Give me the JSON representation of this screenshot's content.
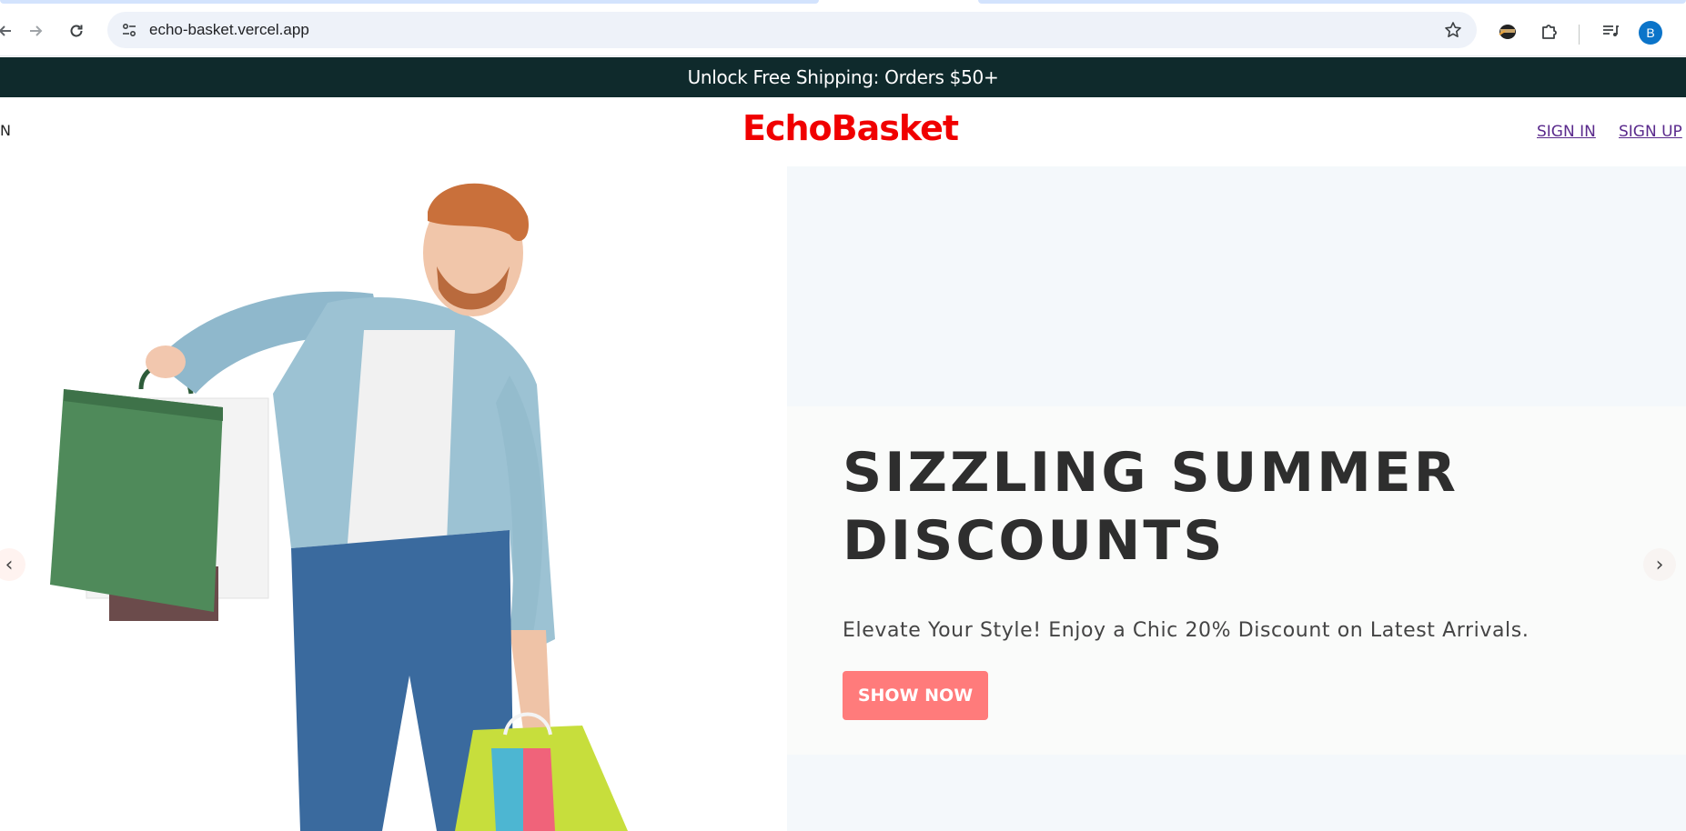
{
  "browser": {
    "url": "echo-basket.vercel.app",
    "profile_initial": "B",
    "icons": {
      "back": "arrow-left-icon",
      "forward": "arrow-right-icon",
      "reload": "reload-icon",
      "site_info": "tune-icon",
      "bookmark": "star-icon",
      "extension_1": "ninja-extension-icon",
      "extensions": "puzzle-icon",
      "media": "media-queue-icon"
    }
  },
  "announcement": {
    "text": "Unlock Free Shipping: Orders $50+",
    "background": "#0f2a2c"
  },
  "header": {
    "left_fragment": "N",
    "logo": "EchoBasket",
    "logo_color": "#f00000",
    "sign_in": "SIGN IN",
    "sign_up": "SIGN UP"
  },
  "hero": {
    "headline_line1": "SIZZLING SUMMER",
    "headline_line2": "DISCOUNTS",
    "subtitle": "Elevate Your Style! Enjoy a Chic 20% Discount on Latest Arrivals.",
    "cta": "SHOW NOW",
    "cta_color": "#ff7b7b",
    "prev_arrow": "‹",
    "next_arrow": "›"
  }
}
